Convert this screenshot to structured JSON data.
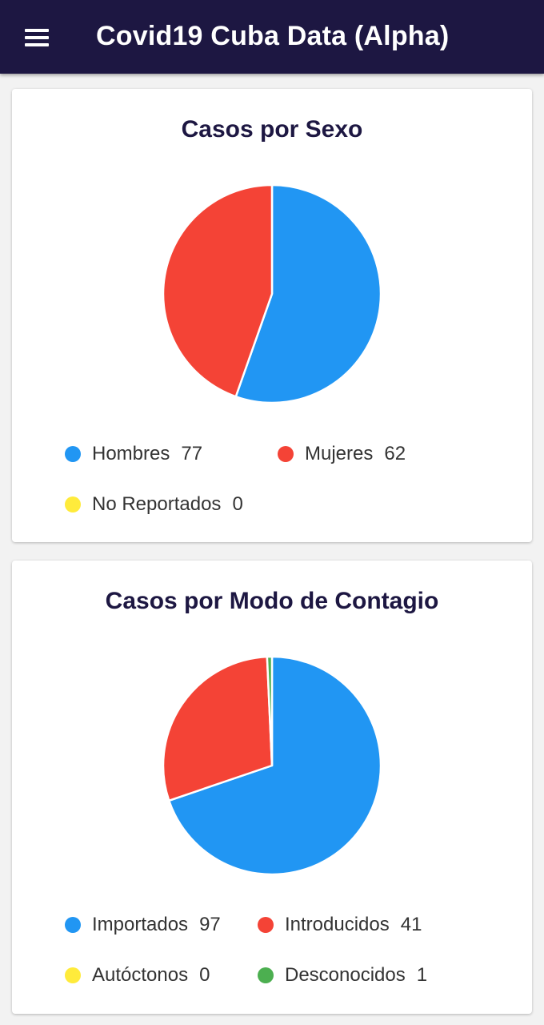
{
  "app": {
    "title": "Covid19 Cuba Data (Alpha)",
    "menu_icon": "hamburger-menu-icon"
  },
  "colors": {
    "appbar": "#1d1742",
    "blue": "#2196f3",
    "red": "#f44336",
    "yellow": "#ffeb3b",
    "green": "#4caf50"
  },
  "cards": {
    "sexo": {
      "title": "Casos por Sexo",
      "legend": [
        {
          "label": "Hombres",
          "value": "77",
          "color": "#2196f3"
        },
        {
          "label": "Mujeres",
          "value": "62",
          "color": "#f44336"
        },
        {
          "label": "No Reportados",
          "value": "0",
          "color": "#ffeb3b"
        }
      ]
    },
    "contagio": {
      "title": "Casos por Modo de Contagio",
      "legend": [
        {
          "label": "Importados",
          "value": "97",
          "color": "#2196f3"
        },
        {
          "label": "Introducidos",
          "value": "41",
          "color": "#f44336"
        },
        {
          "label": "Autóctonos",
          "value": "0",
          "color": "#ffeb3b"
        },
        {
          "label": "Desconocidos",
          "value": "1",
          "color": "#4caf50"
        }
      ]
    }
  },
  "chart_data": [
    {
      "type": "pie",
      "title": "Casos por Sexo",
      "categories": [
        "Hombres",
        "Mujeres",
        "No Reportados"
      ],
      "values": [
        77,
        62,
        0
      ],
      "colors": [
        "#2196f3",
        "#f44336",
        "#ffeb3b"
      ],
      "legend": "bottom"
    },
    {
      "type": "pie",
      "title": "Casos por Modo de Contagio",
      "categories": [
        "Importados",
        "Introducidos",
        "Autóctonos",
        "Desconocidos"
      ],
      "values": [
        97,
        41,
        0,
        1
      ],
      "colors": [
        "#2196f3",
        "#f44336",
        "#ffeb3b",
        "#4caf50"
      ],
      "legend": "bottom"
    }
  ]
}
